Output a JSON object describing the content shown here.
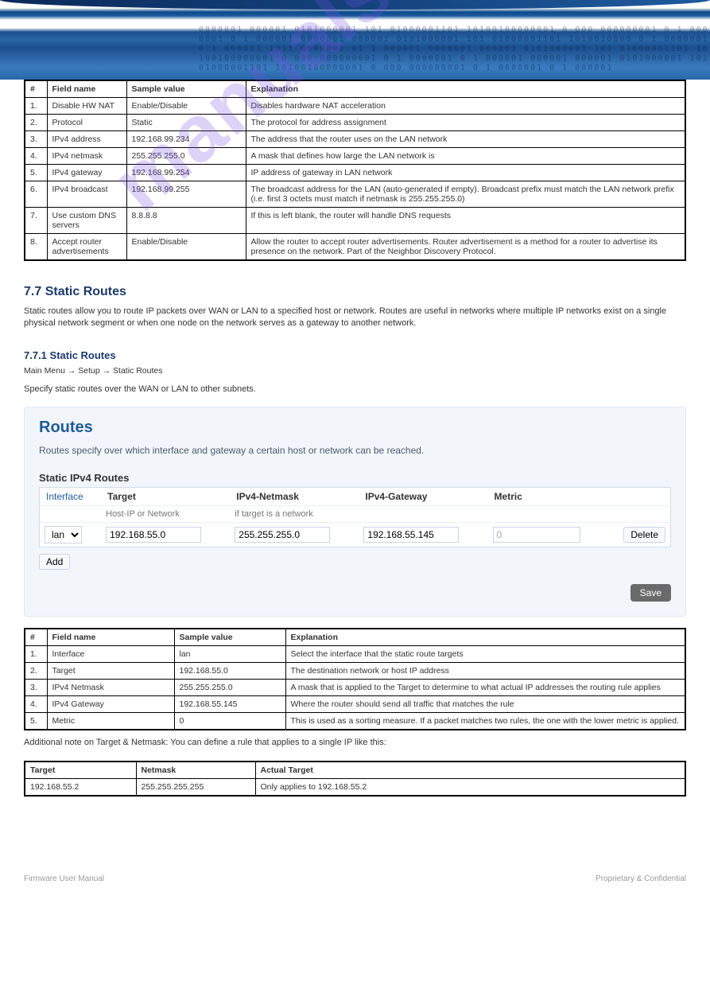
{
  "banner_bits": "0000001 000001 0101000001 101 01000001101 10100100000001 0 000 000000001 0 1 0000001 0 1 000001 0000001 000001 0101000001 101 01000001101 1010010000 0 1 0000001 0 1 000001 1011 0000001 01 1 000001 0000001 000001 0101000001 101 01000001101 10100100000001 0 000 000000001 0 1 0000001 0 1 000001 000001 000001 0101000001 101 01000001101 10100100000001 0 000 000000001 0 1 0000001 0 1 000001",
  "watermark": "manualshive.com",
  "table1": {
    "headers": [
      "#",
      "Field name",
      "Sample value",
      "Explanation"
    ],
    "rows": [
      [
        "1.",
        "Disable HW NAT",
        "Enable/Disable",
        "Disables hardware NAT acceleration"
      ],
      [
        "2.",
        "Protocol",
        "Static",
        "The protocol for address assignment"
      ],
      [
        "3.",
        "IPv4 address",
        "192.168.99.234",
        "The address that the router uses on the LAN network"
      ],
      [
        "4.",
        "IPv4 netmask",
        "255.255.255.0",
        "A mask that defines how large the LAN network is"
      ],
      [
        "5.",
        "IPv4 gateway",
        "192.168.99.254",
        "IP address of gateway in LAN network"
      ],
      [
        "6.",
        "IPv4 broadcast",
        "192.168.99.255",
        "The broadcast address for the LAN (auto-generated if empty). Broadcast prefix must match the LAN network prefix (i.e. first 3 octets must match if netmask is 255.255.255.0)"
      ],
      [
        "7.",
        "Use custom DNS servers",
        "8.8.8.8",
        "If this is left blank, the router will handle DNS requests"
      ],
      [
        "8.",
        "Accept router advertisements",
        "Enable/Disable",
        "Allow the router to accept router advertisements. Router advertisement is a method for a router to advertise its presence on the network. Part of the Neighbor Discovery Protocol."
      ]
    ]
  },
  "static_routes": {
    "heading": "7.7 Static Routes",
    "intro": "Static routes allow you to route IP packets over WAN or LAN to a specified host or network. Routes are useful in networks where multiple IP networks exist on a single physical network segment or when one node on the network serves as a gateway to another network.",
    "sub_heading": "7.7.1 Static Routes",
    "nav": "Main Menu → Setup → Static Routes",
    "desc": "Specify static routes over the WAN or LAN to other subnets."
  },
  "panel": {
    "title": "Routes",
    "subtitle": "Routes specify over which interface and gateway a certain host or network can be reached.",
    "section": "Static IPv4 Routes",
    "cols": [
      "Interface",
      "Target",
      "IPv4-Netmask",
      "IPv4-Gateway",
      "Metric"
    ],
    "hint1": "Host-IP or Network",
    "hint2": "if target is a network",
    "row": {
      "iface": "lan",
      "target": "192.168.55.0",
      "mask": "255.255.255.0",
      "gw": "192.168.55.145",
      "metric": "0"
    },
    "btn_delete": "Delete",
    "btn_add": "Add",
    "btn_save": "Save"
  },
  "table2": {
    "headers": [
      "#",
      "Field name",
      "Sample value",
      "Explanation"
    ],
    "rows": [
      [
        "1.",
        "Interface",
        "lan",
        "Select the interface that the static route targets"
      ],
      [
        "2.",
        "Target",
        "192.168.55.0",
        "The destination network or host IP address"
      ],
      [
        "3.",
        "IPv4 Netmask",
        "255.255.255.0",
        "A mask that is applied to the Target to determine to what actual IP addresses the routing rule applies"
      ],
      [
        "4.",
        "IPv4 Gateway",
        "192.168.55.145",
        "Where the router should send all traffic that matches the rule"
      ],
      [
        "5.",
        "Metric",
        "0",
        "This is used as a sorting measure. If a packet matches two rules, the one with the lower metric is applied."
      ]
    ]
  },
  "table3_intro": "Additional note on Target & Netmask: You can define a rule that applies to a single IP like this:",
  "table3": {
    "headers": [
      "Target",
      "Netmask",
      "Actual Target"
    ],
    "rows": [
      [
        "192.168.55.2",
        "255.255.255.255",
        "Only applies to 192.168.55.2"
      ]
    ]
  },
  "footer": {
    "left": "Firmware User Manual",
    "right": "Proprietary & Confidential"
  }
}
